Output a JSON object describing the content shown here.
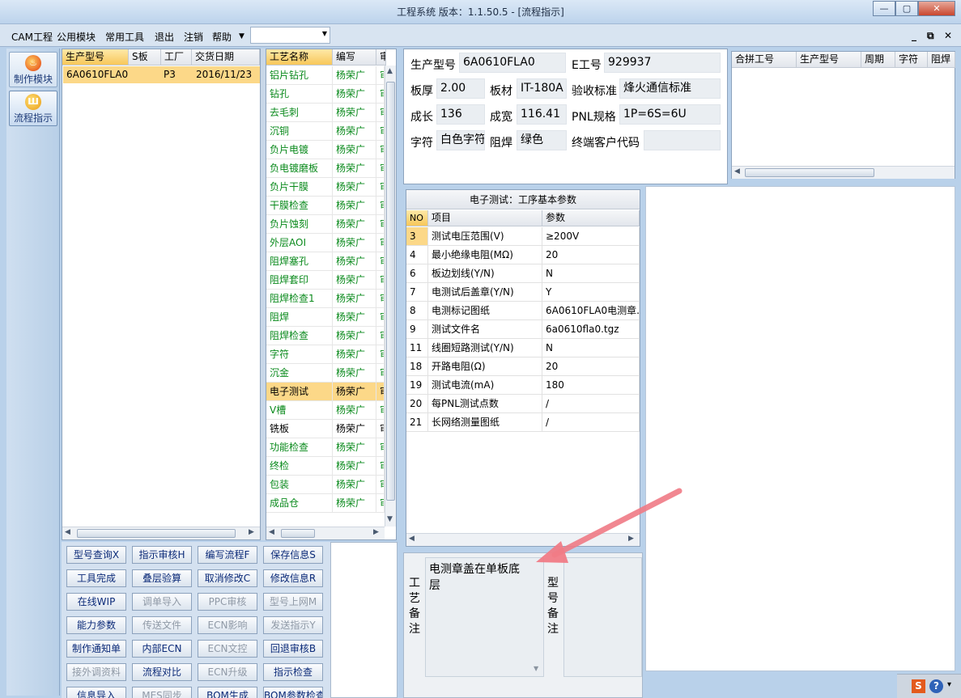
{
  "window": {
    "title": "工程系统  版本：1.1.50.5 - [流程指示]",
    "buttons": [
      "—",
      "▢",
      "✕"
    ]
  },
  "menu": {
    "items": [
      "CAM工程",
      "公用模块",
      "常用工具",
      "退出",
      "注销",
      "帮助"
    ],
    "mdi_buttons": [
      "_",
      "⧉",
      "✕"
    ]
  },
  "left_nav": {
    "items": [
      {
        "label": "制作模块",
        "icon": "fire-icon"
      },
      {
        "label": "流程指示",
        "icon": "flow-icon"
      }
    ]
  },
  "orders_table": {
    "columns": [
      "生产型号",
      "S板",
      "工厂",
      "交货日期"
    ],
    "rows": [
      [
        "6A0610FLA0",
        "",
        "P3",
        "2016/11/23"
      ]
    ]
  },
  "process_list": {
    "columns": [
      "工艺名称",
      "编写",
      "审"
    ],
    "rows": [
      {
        "name": "铝片钻孔",
        "author": "杨荣广"
      },
      {
        "name": "钻孔",
        "author": "杨荣广"
      },
      {
        "name": "去毛刺",
        "author": "杨荣广"
      },
      {
        "name": "沉铜",
        "author": "杨荣广"
      },
      {
        "name": "负片电镀",
        "author": "杨荣广"
      },
      {
        "name": "负电镀磨板",
        "author": "杨荣广"
      },
      {
        "name": "负片干膜",
        "author": "杨荣广"
      },
      {
        "name": "干膜检查",
        "author": "杨荣广"
      },
      {
        "name": "负片蚀刻",
        "author": "杨荣广"
      },
      {
        "name": "外层AOI",
        "author": "杨荣广"
      },
      {
        "name": "阻焊塞孔",
        "author": "杨荣广"
      },
      {
        "name": "阻焊套印",
        "author": "杨荣广"
      },
      {
        "name": "阻焊检查1",
        "author": "杨荣广"
      },
      {
        "name": "阻焊",
        "author": "杨荣广"
      },
      {
        "name": "阻焊检查",
        "author": "杨荣广"
      },
      {
        "name": "字符",
        "author": "杨荣广"
      },
      {
        "name": "沉金",
        "author": "杨荣广"
      },
      {
        "name": "电子测试",
        "author": "杨荣广"
      },
      {
        "name": "V槽",
        "author": "杨荣广"
      },
      {
        "name": "铣板",
        "author": "杨荣广"
      },
      {
        "name": "功能检查",
        "author": "杨荣广"
      },
      {
        "name": "终检",
        "author": "杨荣广"
      },
      {
        "name": "包装",
        "author": "杨荣广"
      },
      {
        "name": "成品仓",
        "author": "杨荣广"
      }
    ],
    "selected_index": 17
  },
  "info": {
    "model_label": "生产型号",
    "model": "6A0610FLA0",
    "eno_label": "E工号",
    "eno": "929937",
    "thickness_label": "板厚",
    "thickness": "2.00",
    "material_label": "板材",
    "material": "IT-180A",
    "standard_label": "验收标准",
    "standard": "烽火通信标准",
    "length_label": "成长",
    "length": "136",
    "width_label": "成宽",
    "width": "116.41",
    "pnl_label": "PNL规格",
    "pnl": "1P=6S=6U",
    "char_label": "字符",
    "char": "白色字符",
    "mask_label": "阻焊",
    "mask": "绿色",
    "customer_label": "终端客户代码",
    "customer": ""
  },
  "merge_table": {
    "columns": [
      "合拼工号",
      "生产型号",
      "周期",
      "字符",
      "阻焊"
    ]
  },
  "params": {
    "title": "电子测试：工序基本参数",
    "columns": [
      "NO",
      "项目",
      "参数"
    ],
    "rows": [
      [
        "3",
        "测试电压范围(V)",
        "≥200V"
      ],
      [
        "4",
        "最小绝缘电阻(MΩ)",
        "20"
      ],
      [
        "6",
        "板边划线(Y/N)",
        "N"
      ],
      [
        "7",
        "电测试后盖章(Y/N)",
        "Y"
      ],
      [
        "8",
        "电测标记图纸",
        "6A0610FLA0电测章."
      ],
      [
        "9",
        "测试文件名",
        "6a0610fla0.tgz"
      ],
      [
        "11",
        "线圈短路测试(Y/N)",
        "N"
      ],
      [
        "18",
        "开路电阻(Ω)",
        "20"
      ],
      [
        "19",
        "测试电流(mA)",
        "180"
      ],
      [
        "20",
        "每PNL测试点数",
        "/"
      ],
      [
        "21",
        "长网络测量图纸",
        "/"
      ]
    ]
  },
  "remarks": {
    "process_label": "工艺备注",
    "process_text": "电测章盖在单板底层",
    "model_label": "型号备注"
  },
  "buttons": [
    [
      "型号查询X",
      "指示审核H",
      "编写流程F",
      "保存信息S"
    ],
    [
      "工具完成",
      "叠层验算",
      "取消修改C",
      "修改信息R"
    ],
    [
      "在线WIP",
      "调单导入",
      "PPC审核",
      "型号上网M"
    ],
    [
      "能力参数",
      "传送文件",
      "ECN影响",
      "发送指示Y"
    ],
    [
      "制作通知单",
      "内部ECN",
      "ECN文控",
      "回退审核B"
    ],
    [
      "接外调资料",
      "流程对比",
      "ECN升级",
      "指示检查"
    ],
    [
      "信息导入",
      "MES同步",
      "BOM生成",
      "BOM参数检查"
    ]
  ],
  "disabled_buttons": [
    "调单导入",
    "PPC审核",
    "型号上网M",
    "传送文件",
    "ECN影响",
    "发送指示Y",
    "ECN文控",
    "接外调资料",
    "ECN升级",
    "MES同步"
  ],
  "annotation_arrow_color": "#f07b86"
}
